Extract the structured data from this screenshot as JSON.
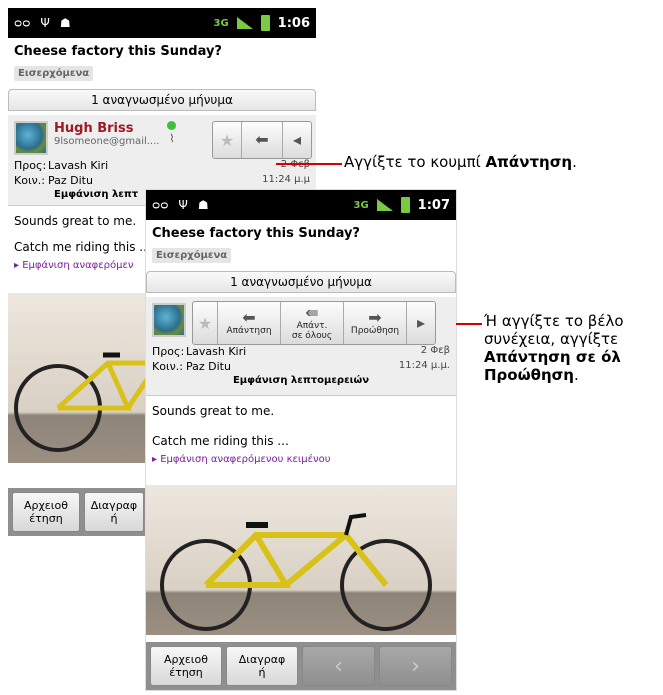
{
  "status1": {
    "time": "1:06"
  },
  "status2": {
    "time": "1:07"
  },
  "email": {
    "subject": "Cheese factory this Sunday?",
    "label": "Εισερχόμενα",
    "unread_bar": "1 αναγνωσμένο μήνυμα",
    "sender_name": "Hugh Briss",
    "sender_email": "9lsomeone@gmail....",
    "to_label": "Προς:",
    "to_value": "Lavash Kiri",
    "cc_label": "Κοιν.:",
    "cc_value": "Paz Ditu",
    "date_short": "2 Φεβ",
    "time": "11:24 μ.μ.",
    "details_link": "Εμφάνιση λεπτομερειών",
    "body1": "Sounds great to me.",
    "body2": "Catch me riding this ...",
    "quoted_link": "▸ Εμφάνιση αναφερόμενου κειμένου"
  },
  "phone1_partial": {
    "details_trunc": "Εμφάνιση λεπτ",
    "body2_trunc": "Catch me riding this ..",
    "quoted_trunc": "▸ Εμφάνιση αναφερόμεν",
    "archive": "Αρχειοθ\nέτηση",
    "delete_trunc": "Διαγραφ\nή",
    "time_trunc": "11:24 μ.μ"
  },
  "actions": {
    "reply": "Απάντηση",
    "reply_all": "Απάντ.\nσε όλους",
    "forward": "Προώθηση"
  },
  "bottom": {
    "archive": "Αρχειοθ\nέτηση",
    "delete": "Διαγραφ\nή",
    "prev": "‹",
    "next": "›"
  },
  "callouts": {
    "c1_text": "Αγγίξτε το κουμπί ",
    "c1_bold": "Απάντηση",
    "c1_end": ".",
    "c2_line1": "Ή αγγίξτε το βέλο",
    "c2_line2": "συνέχεια, αγγίξτε",
    "c2_bold1": "Απάντηση σε όλ",
    "c2_bold2": "Προώθηση",
    "c2_end": "."
  },
  "colors": {
    "sender": "#9d1a26",
    "leader": "#d40000",
    "online": "#3fbf3f"
  }
}
